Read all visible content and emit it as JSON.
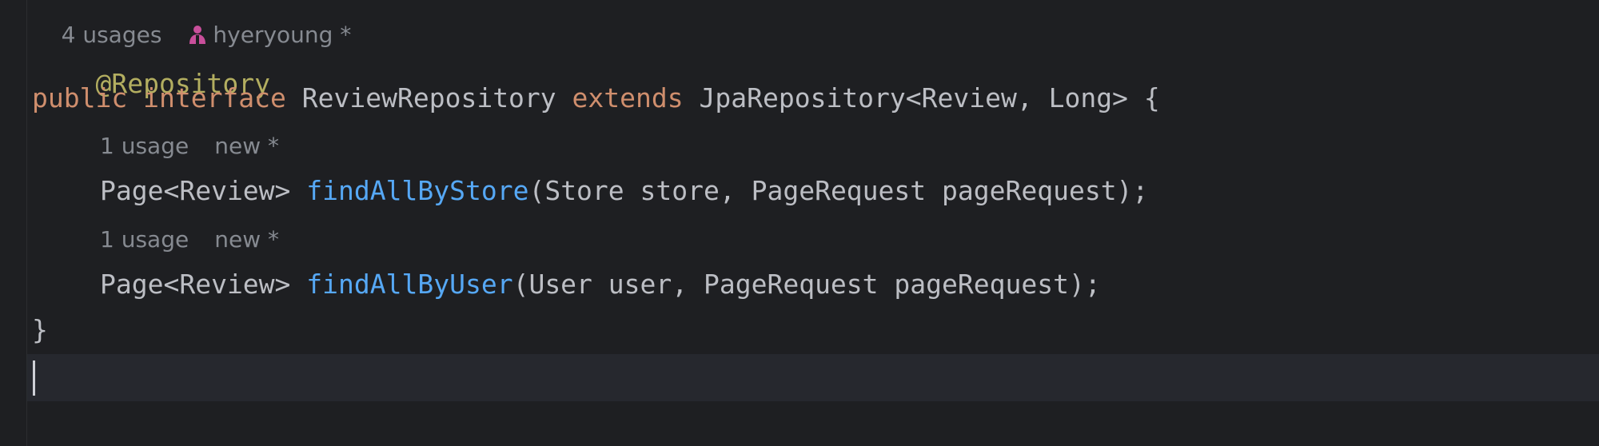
{
  "editor": {
    "header_hint": {
      "usages": "4 usages",
      "author": "hyeryoung *",
      "author_icon": "user-icon"
    },
    "annotation": "@Repository",
    "declaration": {
      "kw_public": "public",
      "kw_interface": "interface",
      "name": "ReviewRepository",
      "kw_extends": "extends",
      "super_type": "JpaRepository<Review, Long>",
      "open_brace": "{"
    },
    "methods": [
      {
        "hint_usages": "1 usage",
        "hint_author": "new *",
        "return_type": "Page<Review>",
        "name": "findAllByStore",
        "params": "(Store store, PageRequest pageRequest);"
      },
      {
        "hint_usages": "1 usage",
        "hint_author": "new *",
        "return_type": "Page<Review>",
        "name": "findAllByUser",
        "params": "(User user, PageRequest pageRequest);"
      }
    ],
    "close_brace": "}"
  },
  "colors": {
    "background": "#1e1f22",
    "keyword": "#cf8e6d",
    "annotation": "#b3ae60",
    "method": "#56a8f5",
    "text": "#bcbec4",
    "hint": "#868a91",
    "author_icon": "#c94f9b"
  }
}
